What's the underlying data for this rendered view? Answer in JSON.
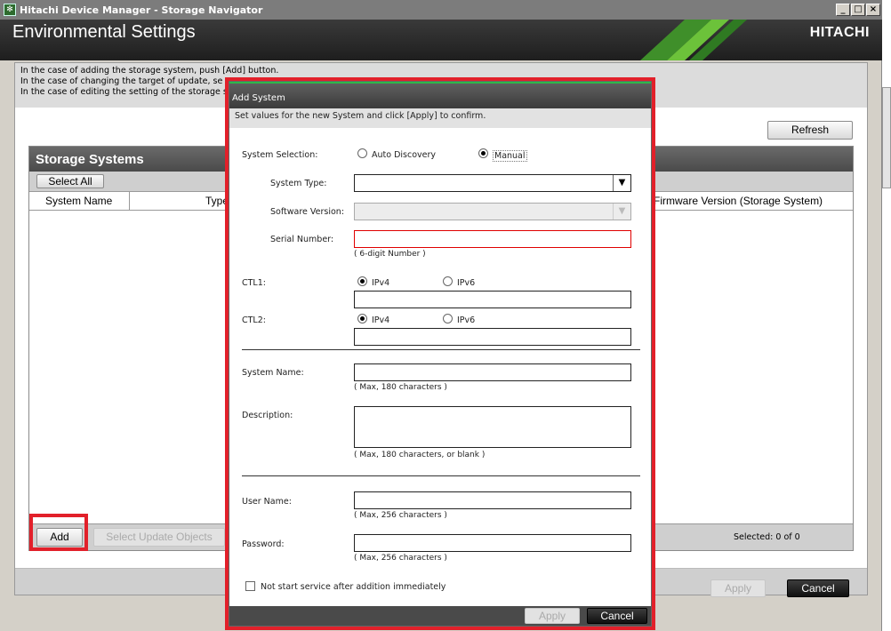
{
  "window": {
    "title": "Hitachi Device Manager - Storage Navigator",
    "minimize": "_",
    "maximize": "□",
    "close": "×"
  },
  "header": {
    "title": "Environmental Settings",
    "brand": "HITACHI"
  },
  "info": {
    "line1": "In the case of adding the storage system, push [Add] button.",
    "line2": "In the case of changing the target of update, se",
    "line3": "In the case of editing the setting of the storage s"
  },
  "toolbar": {
    "refresh": "Refresh"
  },
  "panel": {
    "title": "Storage Systems",
    "select_all": "Select All",
    "columns": [
      "System Name",
      "Type",
      "Firmware Version (Storage System)"
    ],
    "add": "Add",
    "select_update": "Select Update Objects",
    "selected": "Selected: 0 of 0"
  },
  "footer": {
    "apply": "Apply",
    "cancel": "Cancel"
  },
  "dialog": {
    "title": "Add System",
    "description": "Set values for the new System and click [Apply] to confirm.",
    "system_selection_label": "System Selection:",
    "auto_discovery": "Auto Discovery",
    "manual": "Manual",
    "system_type_label": "System Type:",
    "system_type_value": "",
    "software_version_label": "Software Version:",
    "software_version_value": "",
    "serial_number_label": "Serial Number:",
    "serial_number_value": "",
    "serial_hint": "( 6-digit Number )",
    "ctl1_label": "CTL1:",
    "ctl2_label": "CTL2:",
    "ipv4": "IPv4",
    "ipv6": "IPv6",
    "ctl1_value": "",
    "ctl2_value": "",
    "system_name_label": "System Name:",
    "system_name_value": "",
    "system_name_hint": "( Max, 180 characters )",
    "description_label": "Description:",
    "description_value": "",
    "description_hint": "( Max, 180 characters, or blank )",
    "user_name_label": "User Name:",
    "user_name_value": "",
    "user_name_hint": "( Max, 256 characters )",
    "password_label": "Password:",
    "password_value": "",
    "password_hint": "( Max, 256 characters )",
    "not_start_label": "Not start service after addition immediately",
    "apply": "Apply",
    "cancel": "Cancel"
  },
  "colors": {
    "highlight": "#e2202a",
    "header_bg": "#2a2a2a",
    "error_border": "#e00000"
  }
}
